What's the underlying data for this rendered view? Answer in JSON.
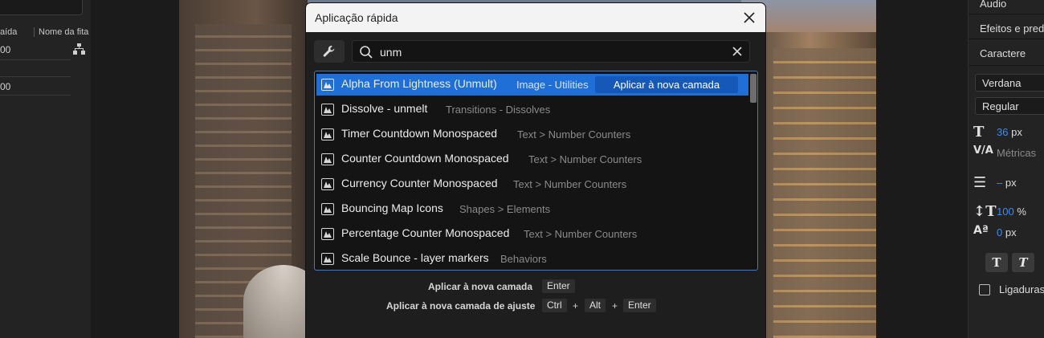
{
  "left_panel": {
    "col1_header": "aída",
    "col2_header": "Nome da fita",
    "row1_value": "00",
    "row2_value": "00"
  },
  "dialog": {
    "title": "Aplicação rápida",
    "search": {
      "value": "unm",
      "placeholder": ""
    },
    "results": [
      {
        "name": "Alpha From Lightness (Unmult)",
        "category": "Image - Utilities",
        "selected": true
      },
      {
        "name": "Dissolve - unmelt",
        "category": "Transitions - Dissolves"
      },
      {
        "name": "Timer Countdown Monospaced",
        "category": "Text > Number Counters"
      },
      {
        "name": "Counter Countdown Monospaced",
        "category": "Text > Number Counters"
      },
      {
        "name": "Currency Counter Monospaced",
        "category": "Text > Number Counters"
      },
      {
        "name": "Bouncing Map Icons",
        "category": "Shapes > Elements"
      },
      {
        "name": "Percentage Counter Monospaced",
        "category": "Text > Number Counters"
      },
      {
        "name": "Scale Bounce - layer markers",
        "category": "Behaviors"
      }
    ],
    "apply_new_layer_button": "Aplicar à nova camada",
    "shortcuts": [
      {
        "label": "Aplicar à nova camada",
        "keys": [
          "Enter"
        ]
      },
      {
        "label": "Aplicar à nova camada de ajuste",
        "keys": [
          "Ctrl",
          "Alt",
          "Enter"
        ]
      }
    ],
    "plus": "+"
  },
  "right_panel": {
    "tabs": [
      "Áudio",
      "Efeitos e predefinições",
      "Caractere"
    ],
    "font_family": "Verdana",
    "font_style": "Regular",
    "font_size": "36",
    "font_size_unit": "px",
    "kerning": "Métricas",
    "leading": "–",
    "leading_unit": "px",
    "vertical_scale": "100",
    "vertical_scale_unit": "%",
    "baseline_shift": "0",
    "baseline_shift_unit": "px",
    "ligatures_label": "Ligaduras"
  },
  "colors": {
    "accent": "#1f6fd6",
    "accent_dark": "#1558b8",
    "value_blue": "#3b8cf0"
  }
}
